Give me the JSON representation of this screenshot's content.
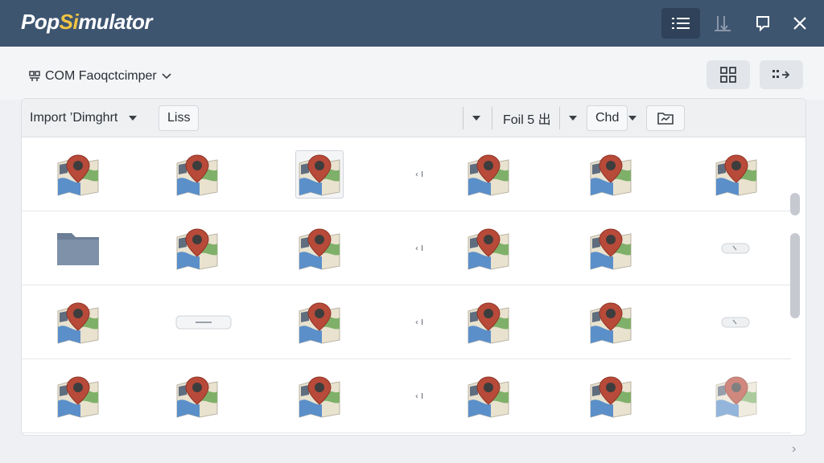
{
  "app": {
    "title_prefix": "Pop",
    "title_accent": "Si",
    "title_suffix": "mulator"
  },
  "titlebar_buttons": [
    {
      "name": "list-view-button",
      "icon": "list-icon",
      "active": true
    },
    {
      "name": "sort-button",
      "icon": "sort-icon",
      "active": false
    },
    {
      "name": "bookmark-button",
      "icon": "bookmark-icon",
      "active": false
    },
    {
      "name": "close-button",
      "icon": "close-icon",
      "active": false
    }
  ],
  "breadcrumb": {
    "label": "COM Faoqctcimper",
    "icon": "grid-small-icon"
  },
  "toolbar": {
    "import_label": "Import ’Dimghrt",
    "list_label": "Liss",
    "filter_label": "Foil 5 出",
    "chd_label": "Chd"
  },
  "grid": {
    "rows": [
      [
        "map",
        "map",
        "map-selected",
        "mark",
        "map",
        "map",
        "map"
      ],
      [
        "folder",
        "map",
        "map",
        "mark",
        "map",
        "map",
        "pill"
      ],
      [
        "map",
        "bar",
        "map",
        "mark",
        "map",
        "map",
        "pill"
      ],
      [
        "map",
        "map",
        "map",
        "mark",
        "map",
        "map",
        "map-light"
      ]
    ],
    "mark_text": "‹ I"
  },
  "colors": {
    "titlebar": "#3e5570",
    "accent": "#f2c443",
    "pin": "#b84a3a",
    "map_water": "#5b8fc9",
    "map_green": "#7fb069",
    "map_land": "#e9e2cf"
  }
}
